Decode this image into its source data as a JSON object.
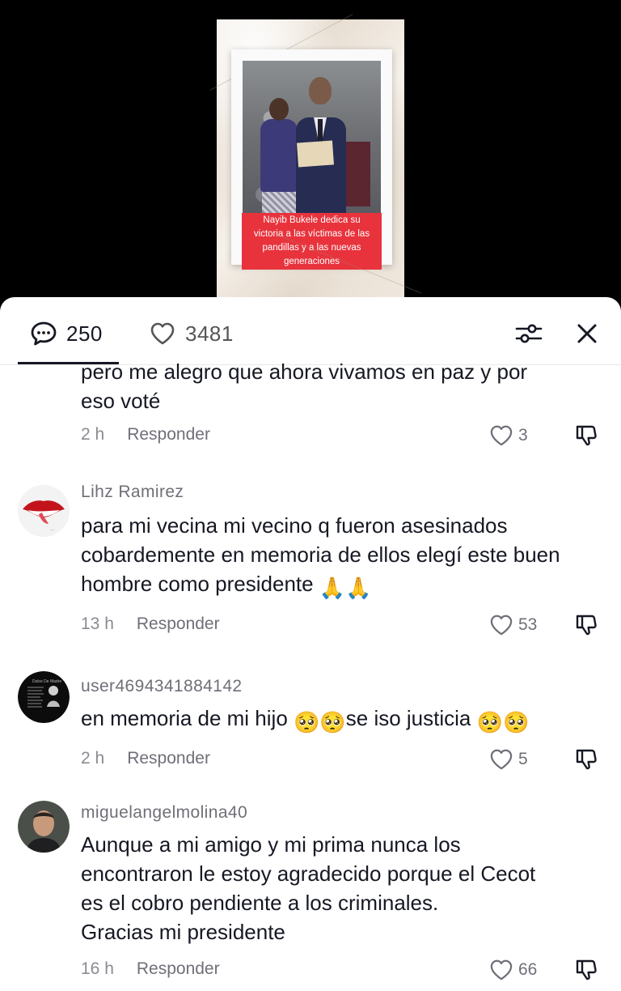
{
  "video": {
    "caption_lines": [
      "Nayib Bukele dedica su",
      "victoria a las víctimas de las",
      "pandillas y a las nuevas",
      "generaciones"
    ]
  },
  "header": {
    "comments_count": "250",
    "likes_count": "3481",
    "comments_icon": "comment-bubble-icon",
    "likes_icon": "heart-outline-icon",
    "filter_icon": "sliders-icon",
    "close_icon": "close-icon"
  },
  "comments": [
    {
      "partial": true,
      "text_lines": [
        "pero me alegro que ahora vivamos en paz y por",
        "eso voté"
      ],
      "time": "2 h",
      "reply_label": "Responder",
      "likes": "3"
    },
    {
      "username": "Lihz Ramirez",
      "text_lines": [
        "para mi vecina mi vecino q fueron asesinados",
        "cobardemente en memoria de ellos elegí este buen",
        "hombre como presidente"
      ],
      "emoji": "🙏🙏",
      "time": "13 h",
      "reply_label": "Responder",
      "likes": "53"
    },
    {
      "username": "user4694341884142",
      "text_parts": [
        "en memoria de mi hijo",
        "se iso justicia"
      ],
      "emoji": "🥺",
      "time": "2 h",
      "reply_label": "Responder",
      "likes": "5"
    },
    {
      "username": "miguelangelmolina40",
      "text_lines": [
        "Aunque a mi amigo y mi prima nunca los",
        "encontraron le estoy agradecido porque el Cecot",
        "es el cobro pendiente a los criminales.",
        "Gracias mi presidente"
      ],
      "time": "16 h",
      "reply_label": "Responder",
      "likes": "66"
    }
  ],
  "colors": {
    "caption_bg": "#e8333d",
    "text_primary": "#161823",
    "text_secondary": "#8a8b91"
  }
}
